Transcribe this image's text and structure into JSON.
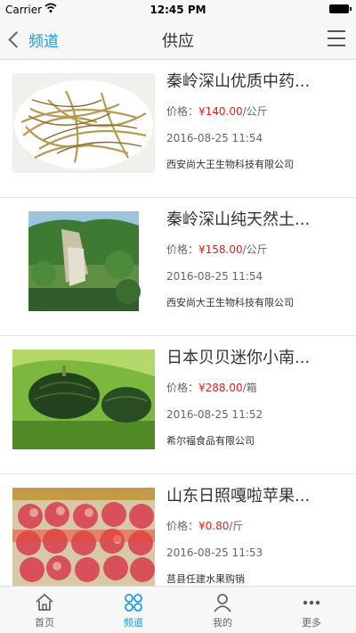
{
  "status": {
    "carrier": "Carrier",
    "time": "12:45 PM"
  },
  "nav": {
    "back_label": "频道",
    "title": "供应"
  },
  "items": [
    {
      "title": "秦岭深山优质中药...",
      "price_label": "价格：",
      "price": "¥140.00",
      "unit": "/公斤",
      "date": "2016-08-25 11:54",
      "company": "西安尚大王生物科技有限公司",
      "image": "dried-herb-roots"
    },
    {
      "title": "秦岭深山纯天然土...",
      "price_label": "价格：",
      "price": "¥158.00",
      "unit": "/公斤",
      "date": "2016-08-25 11:54",
      "company": "西安尚大王生物科技有限公司",
      "image": "mountain-waterfall"
    },
    {
      "title": "日本贝贝迷你小南...",
      "price_label": "价格：",
      "price": "¥288.00",
      "unit": "/箱",
      "date": "2016-08-25 11:52",
      "company": "希尔福食品有限公司",
      "image": "green-pumpkins"
    },
    {
      "title": "山东日照嘎啦苹果...",
      "price_label": "价格：",
      "price": "¥0.80",
      "unit": "/斤",
      "date": "2016-08-25 11:53",
      "company": "莒县任建水果购销",
      "image": "apples-in-box"
    }
  ],
  "tabs": [
    {
      "label": "首页",
      "icon": "home-icon"
    },
    {
      "label": "频道",
      "icon": "grid-icon"
    },
    {
      "label": "我的",
      "icon": "person-icon"
    },
    {
      "label": "更多",
      "icon": "more-icon"
    }
  ],
  "colors": {
    "accent": "#1e9be8",
    "price": "#e8201c"
  }
}
